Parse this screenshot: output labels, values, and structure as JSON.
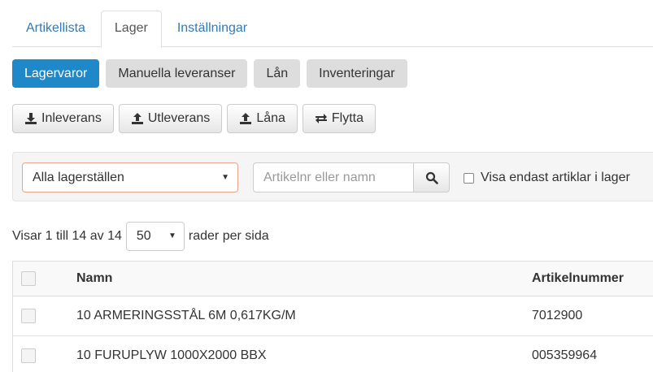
{
  "tabs": [
    {
      "label": "Artikellista",
      "active": false
    },
    {
      "label": "Lager",
      "active": true
    },
    {
      "label": "Inställningar",
      "active": false
    }
  ],
  "pills": [
    {
      "label": "Lagervaror",
      "active": true
    },
    {
      "label": "Manuella leveranser",
      "active": false
    },
    {
      "label": "Lån",
      "active": false
    },
    {
      "label": "Inventeringar",
      "active": false
    }
  ],
  "actions": {
    "inleverans": "Inleverans",
    "utleverans": "Utleverans",
    "lana": "Låna",
    "flytta": "Flytta"
  },
  "filter": {
    "location_selected": "Alla lagerställen",
    "search_placeholder": "Artikelnr eller namn",
    "search_value": "",
    "stock_only_label": "Visa endast artiklar i lager",
    "stock_only_checked": false
  },
  "paging": {
    "info": "Visar 1 till 14 av 14",
    "page_size": "50",
    "suffix": "rader per sida"
  },
  "table": {
    "headers": {
      "name": "Namn",
      "article_number": "Artikelnummer"
    },
    "rows": [
      {
        "name": "10 ARMERINGSSTÅL 6M 0,617KG/M",
        "article_number": "7012900"
      },
      {
        "name": "10 FURUPLYW 1000X2000 BBX",
        "article_number": "005359964"
      }
    ]
  },
  "colors": {
    "primary": "#1e88c9",
    "link": "#337ab7",
    "pill_bg": "#dddddd",
    "select_border": "#e8a48c"
  },
  "icons": {
    "inleverans": "download-icon",
    "utleverans": "upload-icon",
    "lana": "upload-icon",
    "flytta": "exchange-arrows-icon",
    "search": "search-icon",
    "select_caret": "caret-down-icon"
  }
}
